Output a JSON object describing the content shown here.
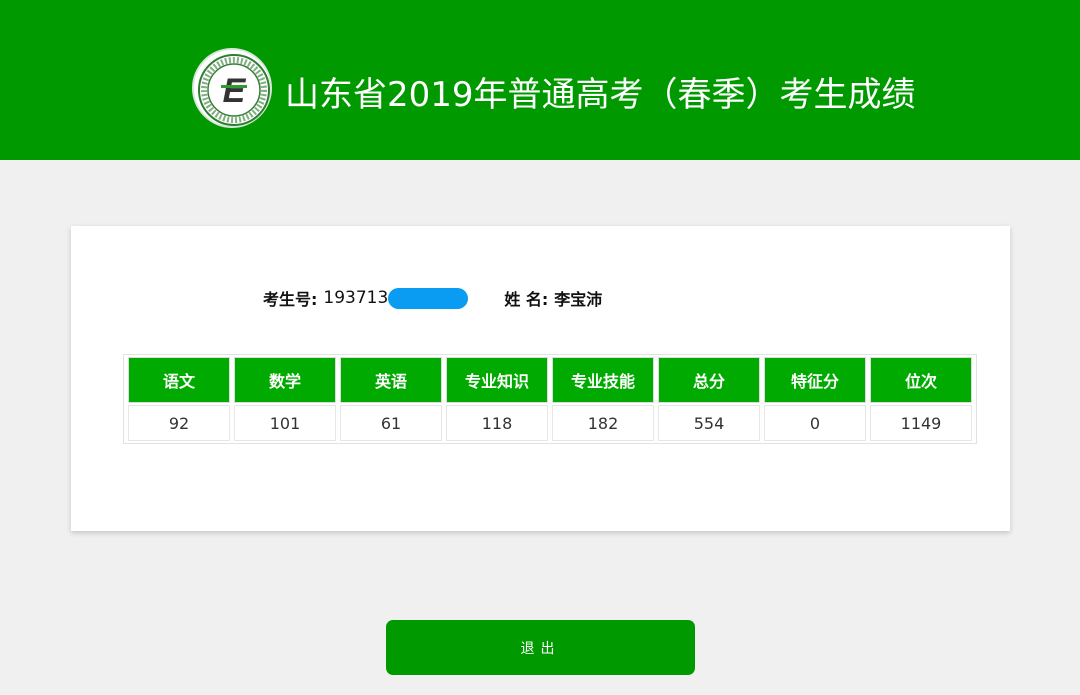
{
  "header": {
    "title": "山东省2019年普通高考（春季）考生成绩",
    "background_color": "#009a00",
    "logo_icon": "education-admission-logo-icon"
  },
  "student": {
    "id_label": "考生号:",
    "id_visible": "193713",
    "name_label": "姓 名:",
    "name_value": "李宝沛",
    "redaction_color": "#0a9bf2"
  },
  "scores": {
    "headers": [
      "语文",
      "数学",
      "英语",
      "专业知识",
      "专业技能",
      "总分",
      "特征分",
      "位次"
    ],
    "values": [
      "92",
      "101",
      "61",
      "118",
      "182",
      "554",
      "0",
      "1149"
    ]
  },
  "actions": {
    "exit_label": "退出"
  }
}
